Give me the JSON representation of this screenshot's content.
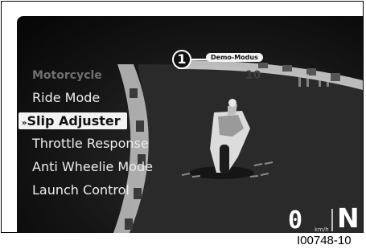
{
  "callout": {
    "number": "1",
    "badge": "Demo-Modus"
  },
  "faded_value": "10",
  "menu": {
    "header": "Motorcycle",
    "items": [
      {
        "label": "Ride Mode",
        "selected": false
      },
      {
        "label": "Slip Adjuster",
        "selected": true,
        "prefix_icon": "double-chevron-right-icon"
      },
      {
        "label": "Throttle Response",
        "selected": false
      },
      {
        "label": "Anti Wheelie Mode",
        "selected": false
      },
      {
        "label": "Launch Control",
        "selected": false
      }
    ]
  },
  "status": {
    "speed": "0",
    "unit": "km/h",
    "gear": "N"
  },
  "figure_ref": "I00748-10"
}
